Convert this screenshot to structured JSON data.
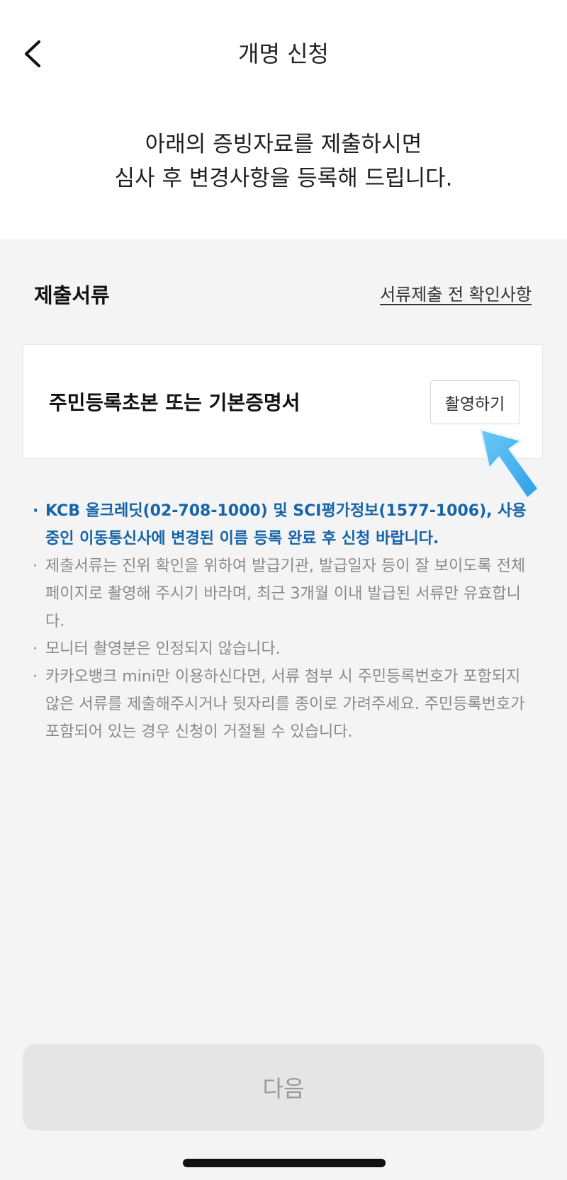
{
  "header": {
    "title": "개명 신청",
    "back_icon": "chevron-left-icon"
  },
  "intro": {
    "line1": "아래의 증빙자료를 제출하시면",
    "line2": "심사 후 변경사항을 등록해 드립니다."
  },
  "documents": {
    "section_label": "제출서류",
    "guide_link": "서류제출 전 확인사항",
    "item": {
      "name": "주민등록초본 또는 기본증명서",
      "action_label": "촬영하기"
    }
  },
  "notes": [
    "KCB 올크레딧(02-708-1000) 및 SCI평가정보(1577-1006), 사용 중인 이동통신사에 변경된 이름 등록 완료 후 신청 바랍니다.",
    "제출서류는 진위 확인을 위하여 발급기관, 발급일자 등이 잘 보이도록 전체 페이지로 촬영해 주시기 바라며, 최근 3개월 이내 발급된 서류만 유효합니다.",
    "모니터 촬영분은 인정되지 않습니다.",
    "카카오뱅크 mini만 이용하신다면, 서류 첨부 시 주민등록번호가 포함되지 않은 서류를 제출해주시거나 뒷자리를 종이로 가려주세요. 주민등록번호가 포함되어 있는 경우 신청이 거절될 수 있습니다."
  ],
  "footer": {
    "next_label": "다음"
  },
  "colors": {
    "emphasis_note": "#1664a8",
    "pointer_arrow": "#45b4f0",
    "disabled_button_bg": "#e5e5e5",
    "section_bg": "#f4f4f4"
  }
}
